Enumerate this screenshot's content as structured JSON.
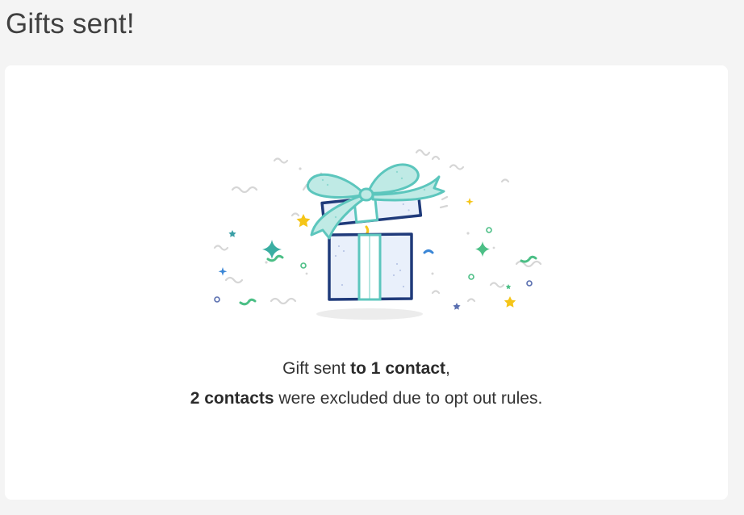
{
  "page": {
    "title": "Gifts sent!"
  },
  "illustration": {
    "icon": "open-gift-box-confetti-icon",
    "colors": {
      "ribbon": "#5cc6bd",
      "box_outline": "#1f3a7a",
      "box_fill": "#e9f0fb",
      "star_yellow": "#f5c518",
      "sparkle_green": "#4cbf86",
      "confetti_blue": "#3a86d6",
      "squiggle_gray": "#d4d4d4"
    }
  },
  "message": {
    "line1_prefix": "Gift sent ",
    "line1_bold": "to 1 contact",
    "line1_suffix": ",",
    "line2_bold": "2 contacts",
    "line2_suffix": " were excluded due to opt out rules."
  }
}
